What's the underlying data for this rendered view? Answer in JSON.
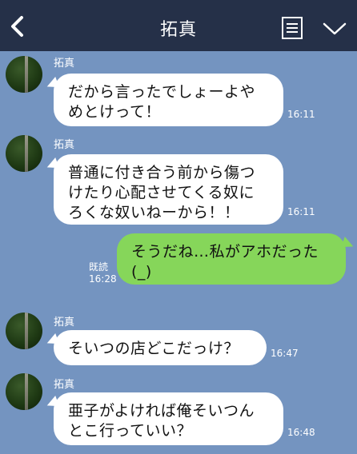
{
  "header": {
    "title": "拓真",
    "back_icon": "chevron-left-icon",
    "menu_icon": "notes-icon",
    "expand_icon": "chevron-down-icon",
    "background": "#253048"
  },
  "colors": {
    "chat_background": "#7494c0",
    "incoming_bubble": "#ffffff",
    "outgoing_bubble": "#86d65a"
  },
  "messages": [
    {
      "sender": "拓真",
      "lines": [
        "だから言ったでしょーよや",
        "めとけって！"
      ],
      "time": "16:11"
    },
    {
      "sender": "拓真",
      "lines": [
        "普通に付き合う前から傷つ",
        "けたり心配させてくる奴に",
        "ろくな奴いねーから！！"
      ],
      "time": "16:11"
    },
    {
      "lines": [
        "そうだね…私がアホだった",
        "(_)"
      ],
      "read": "既読",
      "time": "16:28"
    },
    {
      "sender": "拓真",
      "lines": [
        "そいつの店どこだっけ？"
      ],
      "time": "16:47"
    },
    {
      "sender": "拓真",
      "lines": [
        "亜子がよければ俺そいつん",
        "とこ行っていい？"
      ],
      "time": "16:48"
    }
  ]
}
